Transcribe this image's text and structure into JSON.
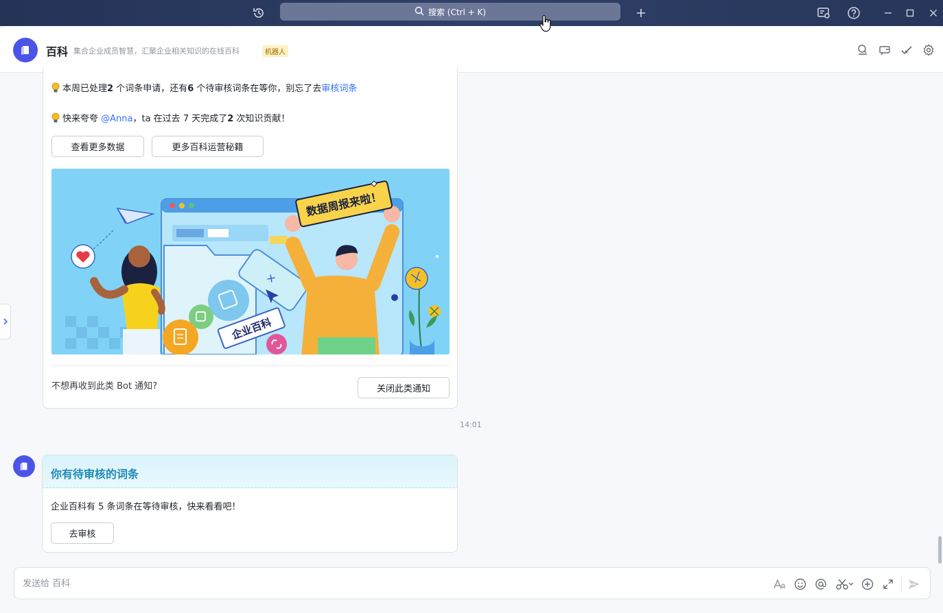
{
  "titlebar": {
    "search_label": "搜索 (Ctrl + K)"
  },
  "header": {
    "title": "百科",
    "description": "集合企业成员智慧，汇聚企业相关知识的在线百科",
    "badge": "机器人"
  },
  "card1": {
    "line1": {
      "prefix": "本周已处理",
      "count1": "2",
      "mid1": " 个词条申请，还有",
      "count2": "6",
      "mid2": " 个待审核词条在等你，别忘了去",
      "link": "审核词条"
    },
    "line2": {
      "prefix": "快来夸夸 ",
      "mention": "@Anna",
      "mid": "，ta 在过去 7 天完成了",
      "count": "2",
      "suffix": " 次知识贡献！"
    },
    "buttons": {
      "more_data": "查看更多数据",
      "more_tips": "更多百科运营秘籍"
    },
    "banner": {
      "sign_text": "数据周报来啦！",
      "tag_text": "企业百科"
    },
    "footer_question": "不想再收到此类 Bot 通知?",
    "close_button": "关闭此类通知"
  },
  "timestamp": "14:01",
  "card2": {
    "title": "你有待审核的词条",
    "body_prefix": "企业百科有 ",
    "body_count": "5",
    "body_suffix": " 条词条在等待审核，快来看看吧！",
    "button": "去审核"
  },
  "input": {
    "placeholder": "发送给 百科"
  },
  "colors": {
    "accent": "#3370ff",
    "brand": "#4a55e8",
    "titlebar": "#2b3a5e"
  }
}
